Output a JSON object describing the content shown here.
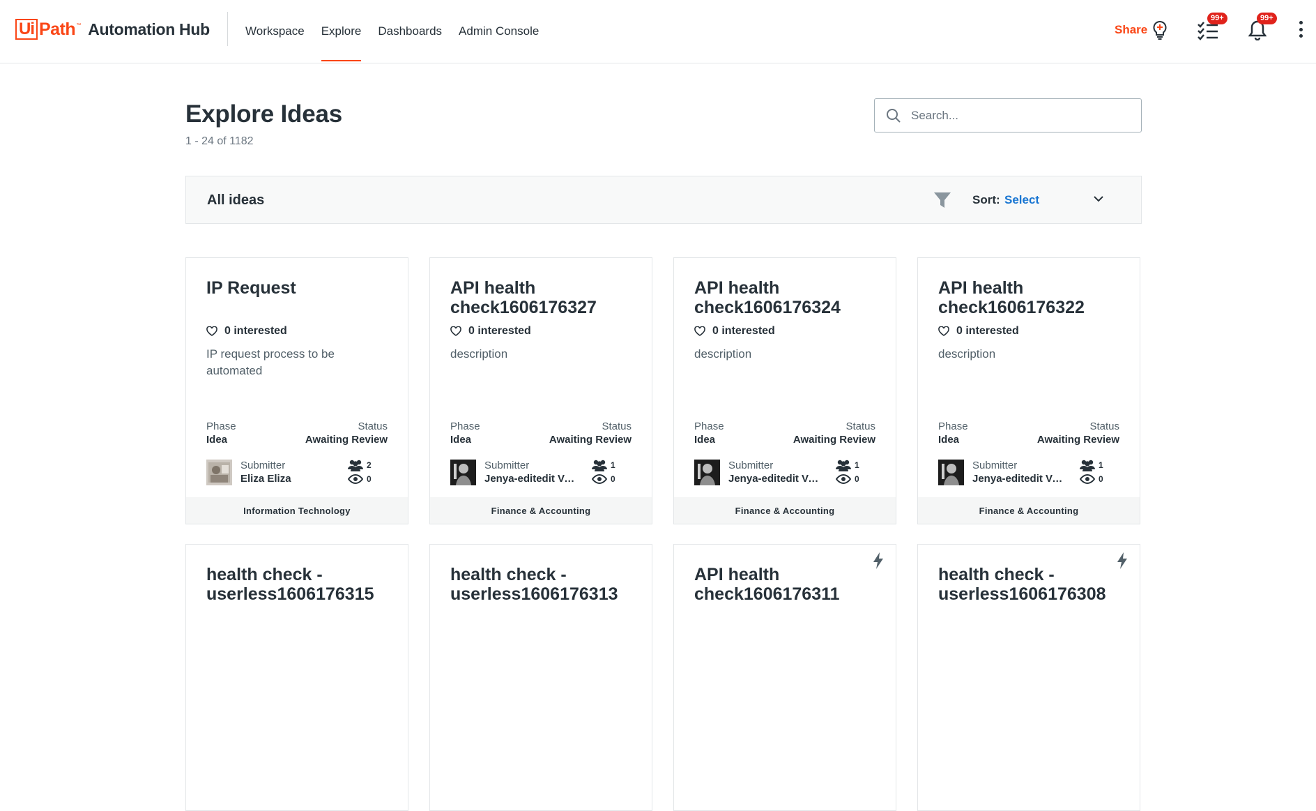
{
  "brand": {
    "logo_ui": "Ui",
    "logo_path": "Path",
    "logo_tm": "™",
    "product": "Automation Hub"
  },
  "nav": [
    {
      "label": "Workspace"
    },
    {
      "label": "Explore",
      "active": true
    },
    {
      "label": "Dashboards"
    },
    {
      "label": "Admin Console"
    }
  ],
  "header_actions": {
    "share_label": "Share",
    "tasks_badge": "99+",
    "notifications_badge": "99+"
  },
  "page": {
    "title": "Explore Ideas",
    "count": "1 - 24 of 1182",
    "search_placeholder": "Search..."
  },
  "filter_bar": {
    "title": "All ideas",
    "sort_label": "Sort:",
    "sort_value": "Select"
  },
  "labels": {
    "phase": "Phase",
    "status": "Status",
    "submitter": "Submitter"
  },
  "cards": [
    {
      "title": "IP Request",
      "interested": "0 interested",
      "description": "IP request process to be automated",
      "phase": "Idea",
      "status": "Awaiting Review",
      "submitter": "Eliza Eliza",
      "collaborators": "2",
      "views": "0",
      "category": "Information Technology"
    },
    {
      "title": "API health check1606176327",
      "interested": "0 interested",
      "description": "description",
      "phase": "Idea",
      "status": "Awaiting Review",
      "submitter": "Jenya-editedit Vas-...",
      "collaborators": "1",
      "views": "0",
      "category": "Finance & Accounting"
    },
    {
      "title": "API health check1606176324",
      "interested": "0 interested",
      "description": "description",
      "phase": "Idea",
      "status": "Awaiting Review",
      "submitter": "Jenya-editedit Vas-...",
      "collaborators": "1",
      "views": "0",
      "category": "Finance & Accounting"
    },
    {
      "title": "API health check1606176322",
      "interested": "0 interested",
      "description": "description",
      "phase": "Idea",
      "status": "Awaiting Review",
      "submitter": "Jenya-editedit Vas-...",
      "collaborators": "1",
      "views": "0",
      "category": "Finance & Accounting"
    },
    {
      "title": "health check - userless1606176315"
    },
    {
      "title": "health check - userless1606176313"
    },
    {
      "title": "API health check1606176311",
      "icon": "bolt-icon"
    },
    {
      "title": "health check - userless1606176308",
      "icon": "bolt-icon"
    }
  ],
  "colors": {
    "accent": "#fa4616",
    "link": "#1976d2",
    "badge": "#e0231c",
    "text": "#273139"
  }
}
